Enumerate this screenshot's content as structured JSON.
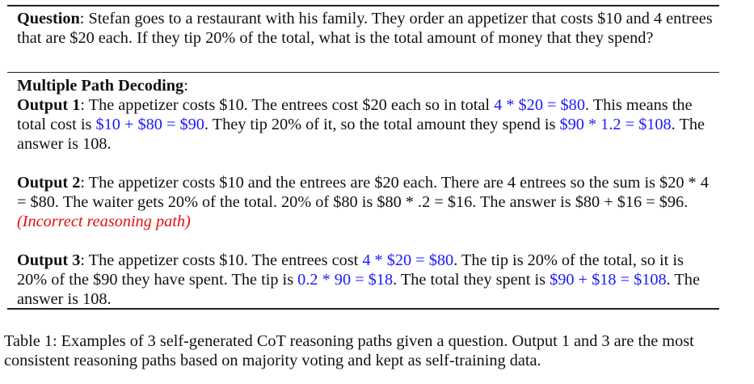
{
  "question": {
    "label": "Question",
    "text": ": Stefan goes to a restaurant with his family. They order an appetizer that costs $10 and 4 entrees that are $20 each. If they tip 20% of the total, what is the total amount of money that they spend?"
  },
  "section_title": "Multiple Path Decoding",
  "section_colon": ":",
  "outputs": [
    {
      "label": "Output 1",
      "parts": [
        {
          "t": ": The appetizer costs $10. The entrees cost $20 each so in total ",
          "hl": ""
        },
        {
          "t": "4 * $20 = $80",
          "hl": "blue"
        },
        {
          "t": ". This means the total cost is ",
          "hl": ""
        },
        {
          "t": "$10 + $80 = $90",
          "hl": "blue"
        },
        {
          "t": ". They tip 20% of it, so the total amount they spend is ",
          "hl": ""
        },
        {
          "t": "$90 * 1.2 = $108",
          "hl": "blue"
        },
        {
          "t": ". The answer is 108.",
          "hl": ""
        }
      ]
    },
    {
      "label": "Output 2",
      "parts": [
        {
          "t": ": The appetizer costs $10 and the entrees are $20 each. There are 4 entrees so the sum is $20 * 4 = $80. The waiter gets 20% of the total. 20% of $80 is $80 * .2 = $16. The answer is $80 + $16 = $96. ",
          "hl": ""
        },
        {
          "t": "(Incorrect reasoning path)",
          "hl": "red"
        }
      ]
    },
    {
      "label": "Output 3",
      "parts": [
        {
          "t": ": The appetizer costs $10. The entrees cost ",
          "hl": ""
        },
        {
          "t": "4 * $20 = $80",
          "hl": "blue"
        },
        {
          "t": ". The tip is 20% of the total, so it is 20% of the $90 they have spent. The tip is ",
          "hl": ""
        },
        {
          "t": "0.2 * 90 = $18",
          "hl": "blue"
        },
        {
          "t": ". The total they spent is ",
          "hl": ""
        },
        {
          "t": "$90 + $18 = $108",
          "hl": "blue"
        },
        {
          "t": ". The answer is 108.",
          "hl": ""
        }
      ]
    }
  ],
  "caption": "Table 1: Examples of 3 self-generated CoT reasoning paths given a question. Output 1 and 3 are the most consistent reasoning paths based on majority voting and kept as self-training data.",
  "colors": {
    "highlight": "#1a1aff",
    "incorrect": "#e01010"
  }
}
